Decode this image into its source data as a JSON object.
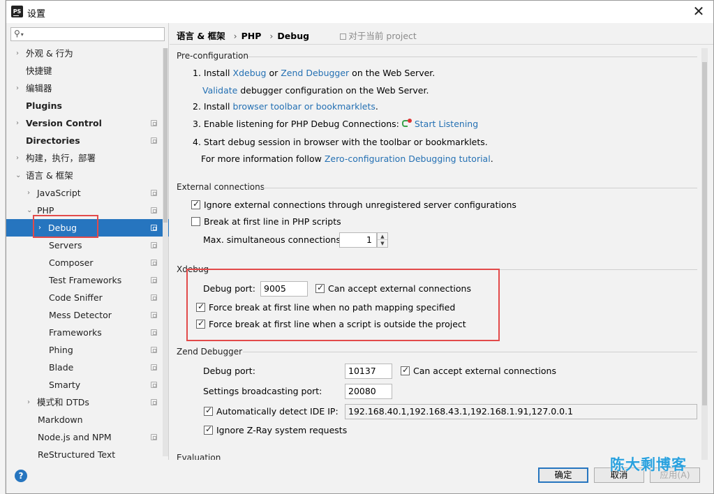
{
  "window": {
    "title": "设置"
  },
  "search": {
    "placeholder": ""
  },
  "sidebar": {
    "items": [
      {
        "label": "外观 & 行为"
      },
      {
        "label": "快捷键"
      },
      {
        "label": "编辑器"
      },
      {
        "label": "Plugins"
      },
      {
        "label": "Version Control"
      },
      {
        "label": "Directories"
      },
      {
        "label": "构建，执行，部署"
      },
      {
        "label": "语言 & 框架"
      },
      {
        "label": "JavaScript"
      },
      {
        "label": "PHP"
      },
      {
        "label": "Debug"
      },
      {
        "label": "Servers"
      },
      {
        "label": "Composer"
      },
      {
        "label": "Test Frameworks"
      },
      {
        "label": "Code Sniffer"
      },
      {
        "label": "Mess Detector"
      },
      {
        "label": "Frameworks"
      },
      {
        "label": "Phing"
      },
      {
        "label": "Blade"
      },
      {
        "label": "Smarty"
      },
      {
        "label": "模式和 DTDs"
      },
      {
        "label": "Markdown"
      },
      {
        "label": "Node.js and NPM"
      },
      {
        "label": "ReStructured Text"
      }
    ]
  },
  "breadcrumb": {
    "part1": "语言 & 框架",
    "part2": "PHP",
    "part3": "Debug",
    "project_note": "对于当前 project"
  },
  "preconfig": {
    "title": "Pre-configuration",
    "l1_pre": "1. Install ",
    "l1_xdebug": "Xdebug",
    "l1_or": " or ",
    "l1_zend": "Zend Debugger",
    "l1_post": " on the Web Server.",
    "l1b_validate": "Validate",
    "l1b_post": " debugger configuration on the Web Server.",
    "l2_pre": "2. Install ",
    "l2_link": "browser toolbar or bookmarklets",
    "l2_post": ".",
    "l3_pre": "3. Enable listening for PHP Debug Connections: ",
    "l3_link": "Start Listening",
    "l4": "4. Start debug session in browser with the toolbar or bookmarklets.",
    "l4b_pre": "For more information follow ",
    "l4b_link": "Zero-configuration Debugging tutorial",
    "l4b_post": "."
  },
  "external": {
    "title": "External connections",
    "ignore_label": "Ignore external connections through unregistered server configurations",
    "ignore_checked": true,
    "break_label": "Break at first line in PHP scripts",
    "break_checked": false,
    "max_label": "Max. simultaneous connections:",
    "max_value": "1"
  },
  "xdebug": {
    "title": "Xdebug",
    "port_label": "Debug port:",
    "port_value": "9005",
    "accept_label": "Can accept external connections",
    "accept_checked": true,
    "force1_label": "Force break at first line when no path mapping specified",
    "force1_checked": true,
    "force2_label": "Force break at first line when a script is outside the project",
    "force2_checked": true
  },
  "zend": {
    "title": "Zend Debugger",
    "port_label": "Debug port:",
    "port_value": "10137",
    "accept_label": "Can accept external connections",
    "accept_checked": true,
    "broadcast_label": "Settings broadcasting port:",
    "broadcast_value": "20080",
    "detect_label": "Automatically detect IDE IP:",
    "detect_checked": true,
    "detect_value": "192.168.40.1,192.168.43.1,192.168.1.91,127.0.0.1",
    "zray_label": "Ignore Z-Ray system requests",
    "zray_checked": true
  },
  "evaluation": {
    "title": "Evaluation"
  },
  "footer": {
    "ok": "确定",
    "cancel": "取消",
    "apply": "应用(A)",
    "help": "?"
  },
  "watermark": "陈大剩博客",
  "colors": {
    "link": "#2470b3",
    "selection": "#2675bf",
    "highlight": "#e24a4a"
  }
}
